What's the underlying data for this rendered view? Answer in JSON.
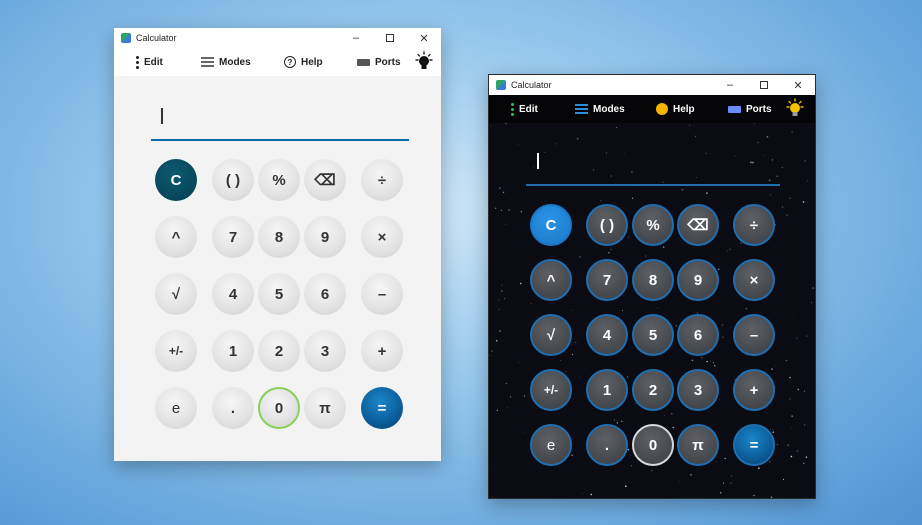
{
  "light_window": {
    "title": "Calculator",
    "controls": {
      "minimize": "–",
      "close": "✕"
    },
    "menu": {
      "edit": "Edit",
      "modes": "Modes",
      "help": "Help",
      "ports": "Ports",
      "help_glyph": "?"
    },
    "display": {
      "cursor": "|"
    },
    "colors": {
      "background": "#f3f3f3",
      "accent_line": "#0b6aa8",
      "clear": "#053f52",
      "equals": "#0b5d9a",
      "zero_ring": "#8ccf5a"
    }
  },
  "dark_window": {
    "title": "Calculator",
    "controls": {
      "minimize": "–",
      "close": "✕"
    },
    "menu": {
      "edit": "Edit",
      "modes": "Modes",
      "help": "Help",
      "ports": "Ports"
    },
    "display": {
      "cursor": "|"
    },
    "colors": {
      "background": "#0b0b14",
      "accent_line": "#1f6fb0",
      "clear": "#1b78c8",
      "equals": "#0b5d9a",
      "zero_ring": "#d8d8d8"
    }
  },
  "keys": [
    [
      "C",
      "( )",
      "%",
      "⌫",
      "÷"
    ],
    [
      "^",
      "7",
      "8",
      "9",
      "×"
    ],
    [
      "√",
      "4",
      "5",
      "6",
      "–"
    ],
    [
      "+/-",
      "1",
      "2",
      "3",
      "+"
    ],
    [
      "e",
      ".",
      "0",
      "π",
      "="
    ]
  ],
  "icons": {
    "edit": "vertical-dots-icon",
    "modes": "hamburger-icon",
    "help": "help-circle-icon",
    "ports": "keyboard-icon",
    "theme": "lightbulb-icon",
    "backspace": "backspace-icon"
  }
}
